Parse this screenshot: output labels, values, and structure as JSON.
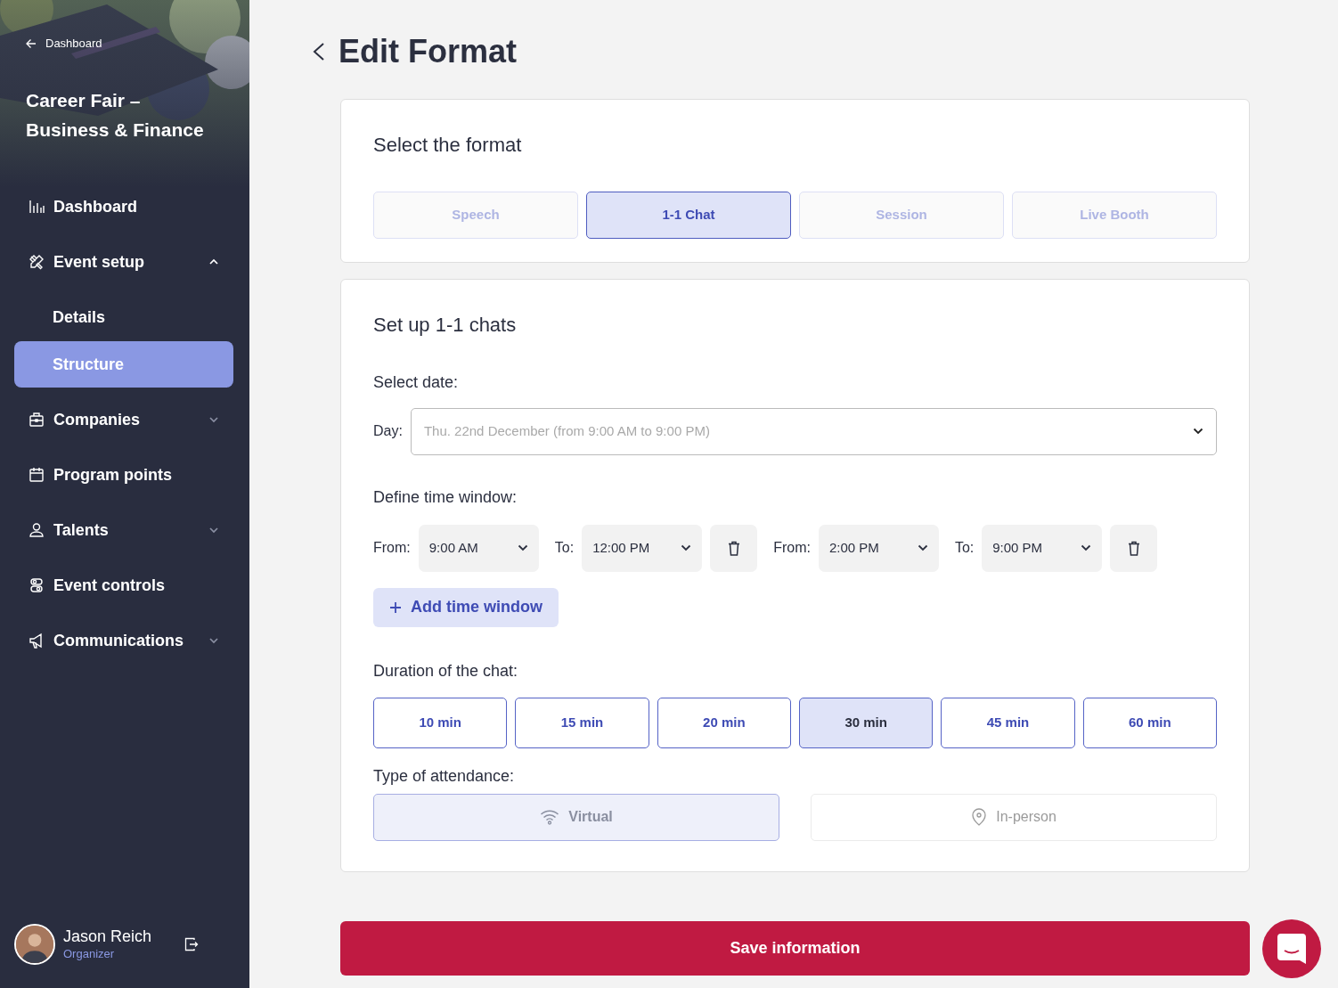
{
  "sidebar": {
    "back_link": "Dashboard",
    "event_title": "Career Fair – Business & Finance",
    "nav": [
      {
        "label": "Dashboard",
        "selected": false
      },
      {
        "label": "Event setup",
        "selected": false,
        "expanded": true,
        "children": [
          {
            "label": "Details",
            "selected": false
          },
          {
            "label": "Structure",
            "selected": true
          }
        ]
      },
      {
        "label": "Companies",
        "selected": false,
        "expanded": false
      },
      {
        "label": "Program points",
        "selected": false
      },
      {
        "label": "Talents",
        "selected": false,
        "expanded": false
      },
      {
        "label": "Event controls",
        "selected": false
      },
      {
        "label": "Communications",
        "selected": false,
        "expanded": false
      }
    ],
    "user": {
      "name": "Jason Reich",
      "role": "Organizer"
    }
  },
  "page_title": "Edit Format",
  "format_card": {
    "title": "Select the format",
    "options": [
      {
        "label": "Speech",
        "selected": false
      },
      {
        "label": "1-1 Chat",
        "selected": true
      },
      {
        "label": "Session",
        "selected": false
      },
      {
        "label": "Live Booth",
        "selected": false
      }
    ]
  },
  "chats_card": {
    "title": "Set up 1-1 chats",
    "date_label": "Select date:",
    "day_label": "Day:",
    "day_value": "Thu. 22nd December (from 9:00 AM to 9:00 PM)",
    "time_window_label": "Define time window:",
    "windows": [
      {
        "from_label": "From:",
        "from": "9:00 AM",
        "to_label": "To:",
        "to": "12:00 PM"
      },
      {
        "from_label": "From:",
        "from": "2:00 PM",
        "to_label": "To:",
        "to": "9:00 PM"
      }
    ],
    "add_button": "Add time window",
    "duration_label": "Duration of the chat:",
    "durations": [
      {
        "label": "10 min",
        "selected": false
      },
      {
        "label": "15 min",
        "selected": false
      },
      {
        "label": "20 min",
        "selected": false
      },
      {
        "label": "30 min",
        "selected": true
      },
      {
        "label": "45 min",
        "selected": false
      },
      {
        "label": "60 min",
        "selected": false
      }
    ],
    "attendance_label": "Type of attendance:",
    "attendance": [
      {
        "label": "Virtual",
        "selected": true
      },
      {
        "label": "In-person",
        "selected": false
      }
    ]
  },
  "save_button": "Save information"
}
